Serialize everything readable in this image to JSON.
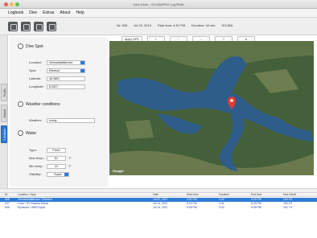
{
  "window": {
    "title": "John Diver - SCUBAPRO LogTRAK"
  },
  "menubar": {
    "items": [
      "Logbook",
      "Dive",
      "Extras",
      "About",
      "Help"
    ]
  },
  "toolbar": {
    "dive_no": "Nr: 638",
    "date": "Jul 22, 2019",
    "start_time": "Start time: 4:51 PM",
    "duration": "Duration: 42 min",
    "mode": "SCUBA"
  },
  "side_tabs": [
    "Location",
    "Details",
    "Profile"
  ],
  "dive_spot": {
    "title": "Dive Spot",
    "location_label": "Location:",
    "location_value": "Vierwaldstättersee",
    "spot_label": "Spot:",
    "spot_value": "Riedsort",
    "latitude_label": "Latitude:",
    "latitude_value": "46.9851",
    "longitude_label": "Longitude:",
    "longitude_value": "8.5327"
  },
  "weather": {
    "title": "Weather conditions",
    "weather_label": "Weather:",
    "weather_value": "sunny"
  },
  "water": {
    "title": "Water",
    "type_label": "Type:",
    "type_value": "Fresh",
    "max_temp_label": "Max.temp.:",
    "max_temp_value": "81",
    "min_temp_label": "Min.temp.:",
    "min_temp_value": "41",
    "temp_unit": "°F",
    "visibility_label": "Visibility:",
    "visibility_value": "Super"
  },
  "map": {
    "buttons": [
      "Apply GPS",
      "+",
      "−",
      "↔",
      "?",
      "⇲"
    ],
    "logo": "Google"
  },
  "dive_table": {
    "headers": [
      "Nr",
      "Location / Spot",
      "Date",
      "Start time",
      "Duration",
      "End time",
      "Max Depth"
    ],
    "rows": [
      {
        "nr": "638",
        "spot": "Vierwaldstättersee / Riedsort",
        "date": "Jul 22, 2019",
        "start": "4:51 PM",
        "duration": "0:42",
        "end": "5:33 PM",
        "depth": "124.3 ft",
        "selected": true
      },
      {
        "nr": "637",
        "spot": "Gozo / HV Kawela Wreck",
        "date": "Jul 14, 2019",
        "start": "8:02 PM",
        "duration": "0:41",
        "end": "8:43 PM",
        "depth": "154.3 ft",
        "selected": false
      },
      {
        "nr": "636",
        "spot": "Plymouth / HMS Scylla",
        "date": "Jul 14, 2019",
        "start": "5:06 PM",
        "duration": "0:43",
        "end": "5:49 PM",
        "depth": "115.7 ft",
        "selected": false
      }
    ]
  },
  "colors": {
    "accent": "#2e7bd6",
    "map_marker": "#e53935",
    "lake": "#2f5d8a",
    "forest": "#3f5a32"
  }
}
